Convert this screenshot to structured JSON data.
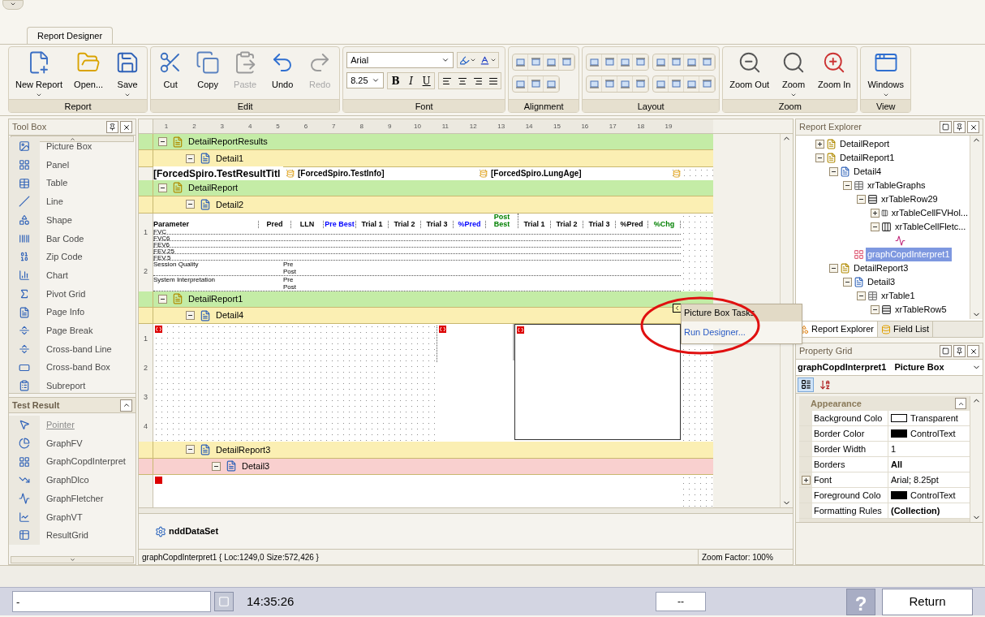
{
  "tabs": [
    {
      "label": "Report Designer",
      "selected": true
    }
  ],
  "ribbon": {
    "groups": [
      {
        "title": "Report",
        "kind": "large",
        "buttons": [
          {
            "label": "New Report",
            "kind": "new",
            "dropdown": true,
            "disabled": false
          },
          {
            "label": "Open...",
            "kind": "open",
            "dropdown": false,
            "disabled": false
          },
          {
            "label": "Save",
            "kind": "save",
            "dropdown": true,
            "disabled": false
          }
        ]
      },
      {
        "title": "Edit",
        "kind": "large",
        "buttons": [
          {
            "label": "Cut",
            "kind": "cut",
            "dropdown": false,
            "disabled": false
          },
          {
            "label": "Copy",
            "kind": "copy",
            "dropdown": false,
            "disabled": false
          },
          {
            "label": "Paste",
            "kind": "paste",
            "dropdown": false,
            "disabled": true
          },
          {
            "label": "Undo",
            "kind": "undo",
            "dropdown": false,
            "disabled": false
          },
          {
            "label": "Redo",
            "kind": "redo",
            "dropdown": false,
            "disabled": true
          }
        ]
      },
      {
        "title": "Font",
        "kind": "font",
        "font_name": "Arial",
        "font_size": "8.25",
        "styles": [
          "B",
          "I",
          "U"
        ]
      },
      {
        "title": "Alignment",
        "kind": "alignment"
      },
      {
        "title": "Layout",
        "kind": "layout"
      },
      {
        "title": "Zoom",
        "kind": "large",
        "buttons": [
          {
            "label": "Zoom Out",
            "kind": "zoom_out",
            "dropdown": false,
            "disabled": false
          },
          {
            "label": "Zoom",
            "kind": "zoom",
            "dropdown": true,
            "disabled": false
          },
          {
            "label": "Zoom In",
            "kind": "zoom_in",
            "dropdown": false,
            "disabled": false
          }
        ]
      },
      {
        "title": "View",
        "kind": "large",
        "buttons": [
          {
            "label": "Windows",
            "kind": "windows",
            "dropdown": true,
            "disabled": false
          }
        ]
      }
    ]
  },
  "toolbox": {
    "title": "Tool Box",
    "items": [
      {
        "label": "Picture Box",
        "kind": "picture"
      },
      {
        "label": "Panel",
        "kind": "panel"
      },
      {
        "label": "Table",
        "kind": "table"
      },
      {
        "label": "Line",
        "kind": "line"
      },
      {
        "label": "Shape",
        "kind": "shape"
      },
      {
        "label": "Bar Code",
        "kind": "barcode"
      },
      {
        "label": "Zip Code",
        "kind": "zipcode"
      },
      {
        "label": "Chart",
        "kind": "chart"
      },
      {
        "label": "Pivot Grid",
        "kind": "pivot"
      },
      {
        "label": "Page Info",
        "kind": "pageinfo"
      },
      {
        "label": "Page Break",
        "kind": "pagebreak"
      },
      {
        "label": "Cross-band Line",
        "kind": "crossline"
      },
      {
        "label": "Cross-band Box",
        "kind": "crossbox"
      },
      {
        "label": "Subreport",
        "kind": "subreport"
      }
    ],
    "group": {
      "title": "Test Result",
      "expanded": true,
      "items": [
        {
          "label": "Pointer",
          "kind": "pointer",
          "selected": true
        },
        {
          "label": "GraphFV",
          "kind": "graph_fv",
          "selected": false
        },
        {
          "label": "GraphCopdInterpret",
          "kind": "copd",
          "selected": false
        },
        {
          "label": "GraphDlco",
          "kind": "dlco",
          "selected": false
        },
        {
          "label": "GraphFletcher",
          "kind": "fletcher",
          "selected": false
        },
        {
          "label": "GraphVT",
          "kind": "vt",
          "selected": false
        },
        {
          "label": "ResultGrid",
          "kind": "grid",
          "selected": false
        }
      ]
    }
  },
  "designer": {
    "ruler": [
      "1",
      "2",
      "3",
      "4",
      "5",
      "6",
      "7",
      "8",
      "9",
      "10",
      "11",
      "12",
      "13",
      "14",
      "15",
      "16",
      "17",
      "18",
      "19"
    ],
    "sections": [
      {
        "kind": "report",
        "label": "DetailReportResults",
        "highlighted": false
      },
      {
        "kind": "detail",
        "label": "Detail1",
        "highlighted": false
      },
      {
        "kind": "fields",
        "fields": [
          {
            "kind": "title",
            "label": "[ForcedSpiro.TestResultTitl"
          },
          {
            "kind": "field",
            "label": "[ForcedSpiro.TestInfo]"
          },
          {
            "kind": "field",
            "label": "[ForcedSpiro.LungAge]"
          }
        ]
      },
      {
        "kind": "report",
        "label": "DetailReport",
        "highlighted": false
      },
      {
        "kind": "detail",
        "label": "Detail2",
        "highlighted": false
      },
      {
        "kind": "table",
        "ruler": [
          "1",
          "2"
        ],
        "columns": [
          {
            "label": "Parameter",
            "color": "#000000"
          },
          {
            "label": "Pred",
            "color": "#000000"
          },
          {
            "label": "LLN",
            "color": "#000000"
          },
          {
            "label": "Pre Best",
            "color": "#0000ff"
          },
          {
            "label": "Trial 1",
            "color": "#000000"
          },
          {
            "label": "Trial 2",
            "color": "#000000"
          },
          {
            "label": "Trial 3",
            "color": "#000000"
          },
          {
            "label": "%Pred",
            "color": "#0000ff"
          },
          {
            "label": "Post Best",
            "color": "#008000"
          },
          {
            "label": "Trial 1",
            "color": "#000000"
          },
          {
            "label": "Trial 2",
            "color": "#000000"
          },
          {
            "label": "Trial 3",
            "color": "#000000"
          },
          {
            "label": "%Pred",
            "color": "#000000"
          },
          {
            "label": "%Chg",
            "color": "#008000"
          }
        ],
        "rows": [
          "FVC",
          "FVC6",
          "FEV6",
          "FEV.25",
          "FEV.5"
        ],
        "notes": [
          {
            "label": "Session Quality",
            "phases": [
              "Pre",
              "Post"
            ]
          },
          {
            "label": "System Interpretation",
            "phases": [
              "Pre",
              "Post"
            ]
          }
        ]
      },
      {
        "kind": "report",
        "label": "DetailReport1",
        "highlighted": false
      },
      {
        "kind": "detail",
        "label": "Detail4",
        "highlighted": false
      },
      {
        "kind": "graphs",
        "ruler": [
          "1",
          "2",
          "3",
          "4"
        ]
      },
      {
        "kind": "detail",
        "label": "DetailReport3",
        "highlighted": false
      },
      {
        "kind": "subdetail",
        "label": "Detail3",
        "highlighted": true
      },
      {
        "kind": "blank"
      }
    ],
    "tray": [
      {
        "label": "nddDataSet"
      }
    ],
    "status": "graphCopdInterpret1 { Loc:1249,0 Size:572,426 }",
    "zoom": "Zoom Factor: 100%",
    "smart_tag": {
      "title": "Picture Box Tasks",
      "action": "Run Designer..."
    }
  },
  "explorer": {
    "title": "Report Explorer",
    "tree": [
      {
        "label": "DetailReport",
        "kind": "report",
        "expanded": false,
        "selected": false
      },
      {
        "label": "DetailReport1",
        "kind": "report",
        "expanded": true,
        "selected": false,
        "children": [
          {
            "label": "Detail4",
            "kind": "detail",
            "expanded": true,
            "selected": false,
            "children": [
              {
                "label": "xrTableGraphs",
                "kind": "table",
                "expanded": true,
                "selected": false,
                "children": [
                  {
                    "label": "xrTableRow29",
                    "kind": "row",
                    "expanded": true,
                    "selected": false,
                    "children": [
                      {
                        "label": "xrTableCellFVHol...",
                        "kind": "cell",
                        "expanded": false,
                        "selected": false
                      },
                      {
                        "label": "xrTableCellFletc...",
                        "kind": "cell",
                        "expanded": true,
                        "selected": false,
                        "children": [
                          {
                            "kind": "graph"
                          }
                        ]
                      }
                    ]
                  }
                ]
              },
              {
                "label": "graphCopdInterpret1",
                "kind": "copd",
                "selected": true
              }
            ]
          },
          {
            "label": "DetailReport3",
            "kind": "report",
            "expanded": true,
            "selected": false,
            "children": [
              {
                "label": "Detail3",
                "kind": "detail",
                "expanded": true,
                "selected": false,
                "children": [
                  {
                    "label": "xrTable1",
                    "kind": "table",
                    "expanded": true,
                    "selected": false,
                    "children": [
                      {
                        "label": "xrTableRow5",
                        "kind": "row",
                        "expanded": true,
                        "selected": false
                      }
                    ]
                  }
                ]
              }
            ]
          }
        ]
      }
    ],
    "tabs": [
      {
        "label": "Report Explorer",
        "selected": true
      },
      {
        "label": "Field List",
        "selected": false
      }
    ]
  },
  "properties": {
    "title": "Property Grid",
    "object": "graphCopdInterpret1",
    "object_type": "Picture Box",
    "category": "Appearance",
    "rows": [
      {
        "name": "Background Colo",
        "value": "Transparent",
        "color": "#ffffff",
        "bold": false,
        "expandable": false
      },
      {
        "name": "Border Color",
        "value": "ControlText",
        "color": "#000000",
        "bold": false,
        "expandable": false
      },
      {
        "name": "Border Width",
        "value": "1",
        "bold": false,
        "expandable": false
      },
      {
        "name": "Borders",
        "value": "All",
        "bold": true,
        "expandable": false
      },
      {
        "name": "Font",
        "value": "Arial; 8.25pt",
        "bold": false,
        "expandable": true
      },
      {
        "name": "Foreground Colo",
        "value": "ControlText",
        "color": "#000000",
        "bold": false,
        "expandable": false
      },
      {
        "name": "Formatting Rules",
        "value": "(Collection)",
        "bold": true,
        "expandable": false
      }
    ]
  },
  "bottom": {
    "input": "-",
    "time": "14:35:26",
    "field": "--",
    "help": "?",
    "return": "Return"
  }
}
